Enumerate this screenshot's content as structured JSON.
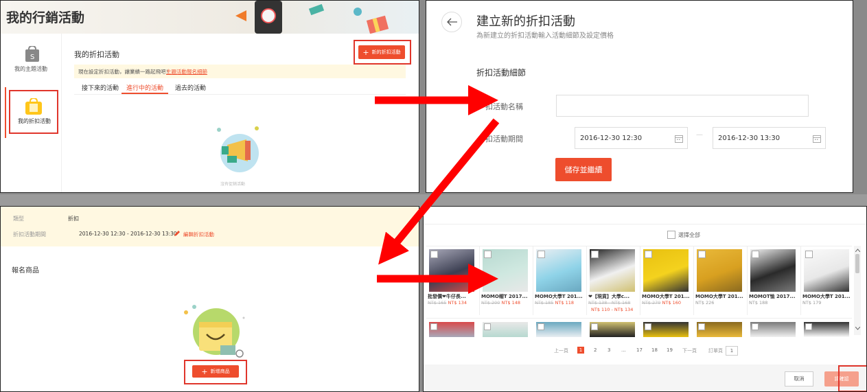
{
  "panel1": {
    "header_title": "我的行銷活動",
    "sidebar": [
      {
        "label": "我的主題活動"
      },
      {
        "label": "我的折扣活動"
      }
    ],
    "section_title": "我的折扣活動",
    "new_button": "新的折扣活動",
    "notice_text": "現在設定折扣活動，讓業績一路起飛吧！",
    "notice_link": "主題活動報名細節",
    "tabs": [
      "接下來的活動",
      "進行中的活動",
      "過去的活動"
    ],
    "active_tab_index": 1,
    "empty_text": "沒有促銷活動"
  },
  "panel2": {
    "title": "建立新的折扣活動",
    "subtitle": "為新建立的折扣活動輸入活動細節及設定價格",
    "section_label": "折扣活動細節",
    "name_label": "扣活動名稱",
    "period_label": "扣活動期間",
    "start_value": "2016-12-30 12:30",
    "end_value": "2016-12-30 13:30",
    "separator": "—",
    "save_button": "儲存並繼續"
  },
  "panel3": {
    "type_label": "類型",
    "type_value": "折扣",
    "period_label": "折扣活動期間",
    "period_value": "2016-12-30 12:30 - 2016-12-30 13:30",
    "edit_link": "編輯折扣活動",
    "registered_label": "報名商品",
    "add_button": "新增商品"
  },
  "panel4": {
    "select_all": "選擇全部",
    "products": [
      {
        "name": "批發價❤牛仔長...",
        "old": "NT$ 165",
        "new": "NT$ 134",
        "extra": ""
      },
      {
        "name": "MOMO帽T 2017...",
        "old": "NT$ 200",
        "new": "NT$ 148",
        "extra": ""
      },
      {
        "name": "MOMO大學T 201...",
        "old": "NT$ 185",
        "new": "NT$ 118",
        "extra": ""
      },
      {
        "name": "❤【現貨】大學c...",
        "old": "NT$ 138 - NT$ 168",
        "new": "",
        "extra": "NT$ 110 - NT$ 134"
      },
      {
        "name": "MOMO大學T 201...",
        "old": "NT$ 279",
        "new": "NT$ 160",
        "extra": ""
      },
      {
        "name": "MOMO大學T 201...",
        "old": "",
        "new": "",
        "plain": "NT$ 226",
        "extra": ""
      },
      {
        "name": "MOMOT恤 2017...",
        "old": "",
        "new": "",
        "plain": "NT$ 188",
        "extra": ""
      },
      {
        "name": "MOMO大學T 201...",
        "old": "",
        "new": "",
        "plain": "NT$ 179",
        "extra": ""
      }
    ],
    "pagination": {
      "prev": "上一頁",
      "pages": [
        "1",
        "2",
        "3",
        "...",
        "17",
        "18",
        "19"
      ],
      "next": "下一頁",
      "jump_label": "訂單頁",
      "jump_value": "1"
    },
    "cancel_button": "取消",
    "confirm_button": "請確認"
  },
  "colors": {
    "accent": "#ee4d2d",
    "highlight_box": "#e0352b",
    "arrow": "#ff0000",
    "notice_bg": "#fff8e1"
  }
}
